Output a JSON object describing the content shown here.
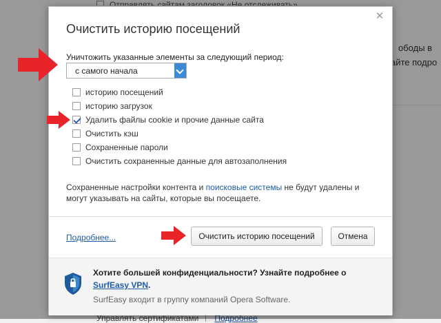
{
  "background": {
    "top_row_text": "Отправлять сайтам заголовок «Не отслеживать»",
    "right_text_1": "ободы в",
    "right_text_2": "айте подро",
    "bottom_row_text": "Управлять сертификатами",
    "bottom_row_link": "Подробнее"
  },
  "dialog": {
    "title": "Очистить историю посещений",
    "close_glyph": "✕",
    "period_label": "Уничтожить указанные элементы за следующий период:",
    "period_value": "с самого начала",
    "options": [
      {
        "label": "историю посещений",
        "checked": false
      },
      {
        "label": "историю загрузок",
        "checked": false
      },
      {
        "label": "Удалить файлы cookie и прочие данные сайта",
        "checked": true
      },
      {
        "label": "Очистить кэш",
        "checked": false
      },
      {
        "label": "Сохраненные пароли",
        "checked": false
      },
      {
        "label": "Очистить сохраненные данные для автозаполнения",
        "checked": false
      }
    ],
    "notice": {
      "part1": "Сохраненные настройки контента и ",
      "link": "поисковые системы",
      "part2": " не будут удалены и могут указывать на сайты, которые вы посещаете."
    },
    "more_link": "Подробнее...",
    "clear_button": "Очистить историю посещений",
    "cancel_button": "Отмена",
    "promo": {
      "title": "Хотите большей конфиденциальности? Узнайте подробнее о",
      "link": "SurfEasy VPN",
      "link_suffix": ".",
      "subtitle": "SurfEasy входит в группу компаний Opera Software."
    }
  },
  "colors": {
    "accent": "#3a8ad6",
    "link": "#1c5cab",
    "annotation_arrow": "#e8232a"
  }
}
